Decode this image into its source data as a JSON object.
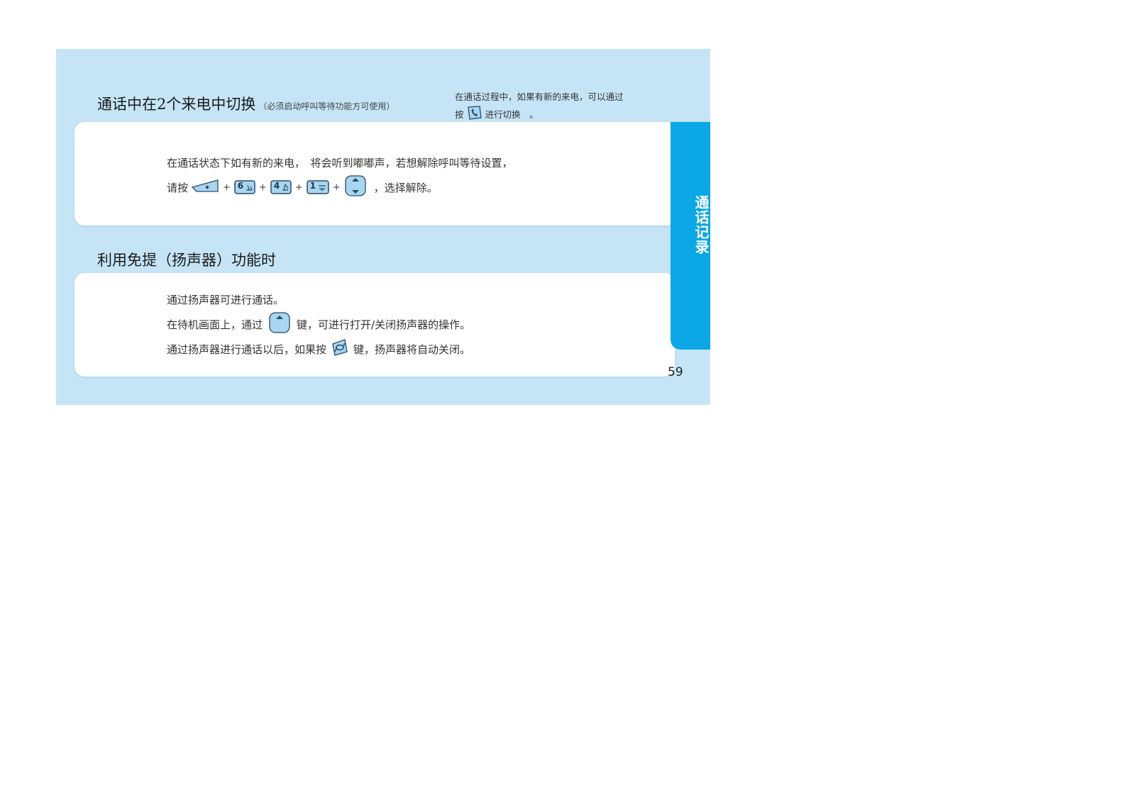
{
  "section1": {
    "title": "通话中在2个来电中切换",
    "subtitle": "（必须启动呼叫等待功能方可使用）",
    "note_line1": "在通话过程中，如果有新的来电，可以通过",
    "note_line2_pre": "按",
    "note_line2_post": "进行切换　。",
    "para1": "在通话状态下如有新的来电，　将会听到嘟嘟声，若想解除呼叫等待设置，",
    "para2_pre": "请按",
    "plus": "+",
    "key6": "6",
    "key4": "4",
    "key1": "1",
    "para2_post": "，选择解除。"
  },
  "section2": {
    "title": "利用免提（扬声器）功能时",
    "para1": "通过扬声器可进行通话。",
    "para2_pre": "在待机画面上，通过",
    "para2_post": "键，可进行打开/关闭扬声器的操作。",
    "para3_pre": "通过扬声器进行通话以后，如果按",
    "para3_post": "键，扬声器将自动关闭。"
  },
  "side_tab": {
    "label": "通话记录"
  },
  "page_number": "59",
  "colors": {
    "page_background": "#c5e5f7",
    "tab": "#0ba7e6",
    "key_fill": "#a8d6f0",
    "key_stroke": "#2b4a66"
  },
  "icons": [
    "soft-key-left-icon",
    "key-6-icon",
    "key-4-icon",
    "key-1-icon",
    "nav-updown-key-icon",
    "nav-up-key-icon",
    "call-send-key-icon",
    "end-call-key-icon"
  ]
}
